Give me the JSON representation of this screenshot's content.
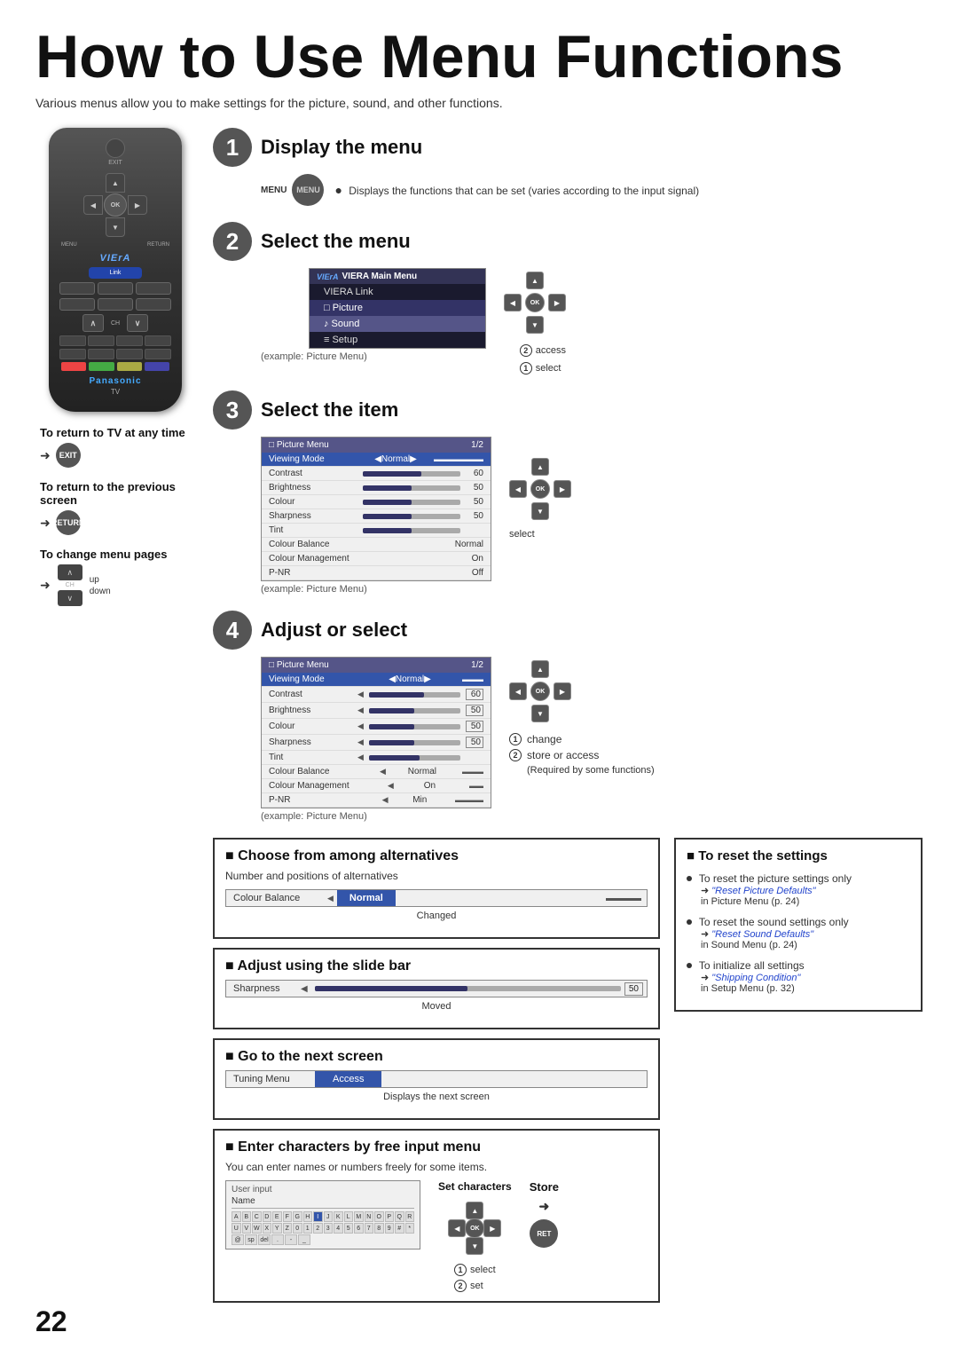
{
  "page": {
    "title": "How to Use Menu Functions",
    "subtitle": "Various menus allow you to make settings for the picture, sound, and other functions.",
    "page_number": "22"
  },
  "steps": {
    "step1": {
      "number": "1",
      "title": "Display the menu",
      "menu_label": "MENU",
      "bullet": "Displays the functions that can be set (varies according to the input signal)"
    },
    "step2": {
      "number": "2",
      "title": "Select the menu",
      "main_menu_label": "VIERA Main Menu",
      "items": [
        "VIERA Link",
        "Picture",
        "Sound",
        "Setup"
      ],
      "example": "(example: Picture Menu)",
      "access_label": "access",
      "select_label": "select"
    },
    "step3": {
      "number": "3",
      "title": "Select the item",
      "menu_header": "Picture Menu",
      "menu_page": "1/2",
      "rows": [
        {
          "label": "Viewing Mode",
          "type": "text",
          "value": "Normal"
        },
        {
          "label": "Contrast",
          "type": "bar",
          "value": 60
        },
        {
          "label": "Brightness",
          "type": "bar",
          "value": 50
        },
        {
          "label": "Colour",
          "type": "bar",
          "value": 50
        },
        {
          "label": "Sharpness",
          "type": "bar",
          "value": 50
        },
        {
          "label": "Tint",
          "type": "bar",
          "value": 50
        },
        {
          "label": "Colour Balance",
          "type": "text",
          "value": "Normal"
        },
        {
          "label": "Colour Management",
          "type": "text",
          "value": "On"
        },
        {
          "label": "P-NR",
          "type": "text",
          "value": "Off"
        }
      ],
      "example": "(example: Picture Menu)",
      "select_label": "select"
    },
    "step4": {
      "number": "4",
      "title": "Adjust or select",
      "menu_header": "Picture Menu",
      "menu_page": "1/2",
      "rows": [
        {
          "label": "Viewing Mode",
          "type": "text",
          "value": "Normal"
        },
        {
          "label": "Contrast",
          "type": "bar",
          "value": 60
        },
        {
          "label": "Brightness",
          "type": "bar",
          "value": 50
        },
        {
          "label": "Colour",
          "type": "bar",
          "value": 50
        },
        {
          "label": "Sharpness",
          "type": "bar",
          "value": 50
        },
        {
          "label": "Tint",
          "type": "bar",
          "value": 50
        },
        {
          "label": "Colour Balance",
          "type": "text",
          "value": "Normal"
        },
        {
          "label": "Colour Management",
          "type": "text",
          "value": "On"
        },
        {
          "label": "P-NR",
          "type": "text",
          "value": "Min"
        }
      ],
      "example": "(example: Picture Menu)",
      "change_label": "change",
      "store_label": "store or access",
      "store_sub": "(Required by some functions)"
    }
  },
  "remote": {
    "exit_label": "EXIT",
    "menu_label": "MENU",
    "return_label": "RETURN",
    "ok_label": "OK",
    "viera_label": "VIErA",
    "link_label": "Link",
    "panasonic_label": "Panasonic",
    "tv_label": "TV",
    "ch_label": "CH"
  },
  "below_remote": {
    "tv_title": "To return to TV at any time",
    "tv_btn": "EXIT",
    "prev_title": "To return to the previous screen",
    "prev_btn": "RETURN",
    "change_title": "To change menu pages",
    "up_label": "up",
    "down_label": "down"
  },
  "bottom": {
    "choose_title": "Choose from among alternatives",
    "choose_sub": "Number and positions of alternatives",
    "cb_label": "Colour Balance",
    "cb_value": "Normal",
    "changed_label": "Changed",
    "slide_title": "Adjust using the slide bar",
    "sharp_label": "Sharpness",
    "sharp_value": "50",
    "moved_label": "Moved",
    "next_title": "Go to the next screen",
    "tuning_label": "Tuning Menu",
    "access_label": "Access",
    "next_sub": "Displays the next screen",
    "enter_title": "Enter characters by free input menu",
    "enter_sub": "You can enter names or numbers freely for some items.",
    "user_input_label": "User input",
    "name_label": "Name",
    "set_chars_label": "Set characters",
    "store_label": "Store",
    "select_label": "select",
    "set_label": "set"
  },
  "reset": {
    "title": "To reset the settings",
    "item1_text": "To reset the picture settings only",
    "item1_link": "\"Reset Picture Defaults\"",
    "item1_sub": "in Picture Menu (p. 24)",
    "item2_text": "To reset the sound settings only",
    "item2_link": "\"Reset Sound Defaults\"",
    "item2_sub": "in Sound Menu (p. 24)",
    "item3_text": "To initialize all settings",
    "item3_link": "\"Shipping Condition\"",
    "item3_sub": "in Setup Menu (p. 32)"
  }
}
